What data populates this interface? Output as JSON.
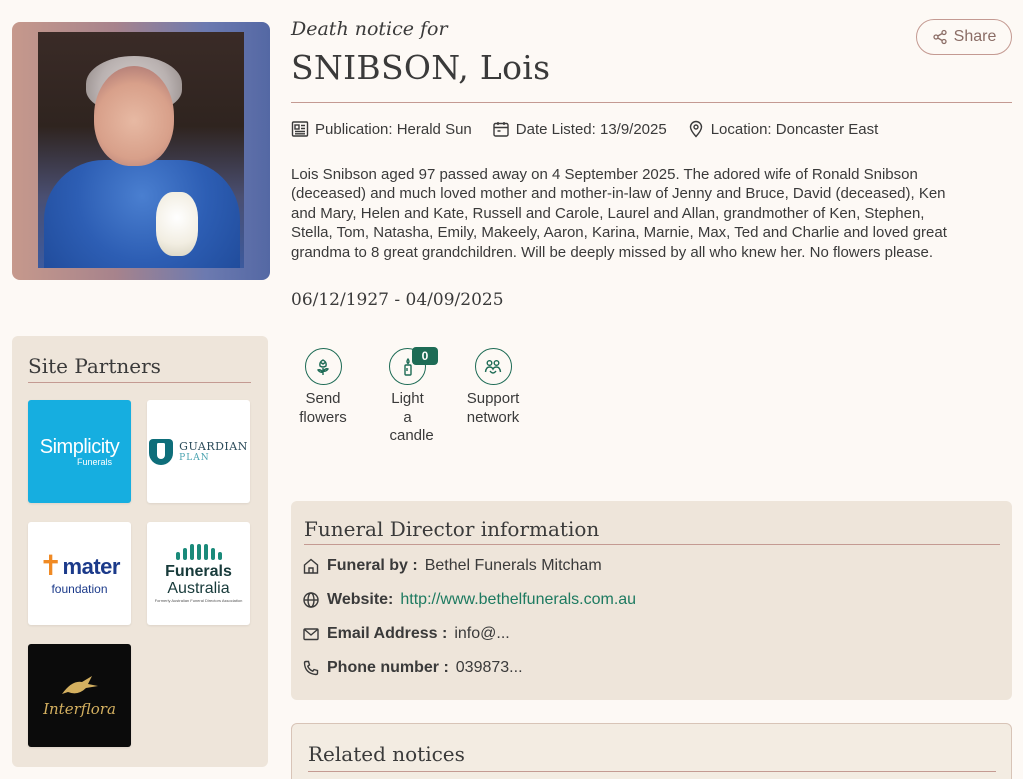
{
  "notice": {
    "heading": "Death notice for",
    "name": "SNIBSON, Lois",
    "share_label": "Share",
    "publication_label": "Publication: Herald Sun",
    "date_listed_label": "Date Listed: 13/9/2025",
    "location_label": "Location: Doncaster East",
    "body": "Lois Snibson aged 97 passed away on 4 September 2025. The adored wife of Ronald Snibson (deceased) and much loved mother and mother-in-law of Jenny and Bruce, David (deceased), Ken and Mary, Helen and Kate, Russell and Carole, Laurel and Allan, grandmother of Ken, Stephen, Stella, Tom, Natasha, Emily, Makeely, Aaron, Karina, Marnie, Max, Ted and Charlie and loved great grandma to 8 great grandchildren. Will be deeply missed by all who knew her. No flowers please.",
    "dates": "06/12/1927 - 04/09/2025"
  },
  "actions": {
    "send_flowers": "Send flowers",
    "light_candle": "Light a candle",
    "candle_count": "0",
    "support_network": "Support network"
  },
  "partners": {
    "title": "Site Partners",
    "simplicity_main": "Simplicity",
    "simplicity_sub": "Funerals",
    "guardian_t1": "GUARDIAN",
    "guardian_t2": "PLAN",
    "mater_word": "mater",
    "mater_sub": "foundation",
    "funerals_t1": "Funerals",
    "funerals_t2": "Australia",
    "funerals_t3": "Formerly Australian Funeral Directors Association",
    "interflora": "Interflora"
  },
  "director": {
    "title": "Funeral Director information",
    "funeral_by_key": "Funeral by :",
    "funeral_by_value": "Bethel Funerals Mitcham",
    "website_key": "Website:",
    "website_value": "http://www.bethelfunerals.com.au",
    "email_key": "Email Address :",
    "email_value": "info@...",
    "phone_key": "Phone number :",
    "phone_value": "039873..."
  },
  "related": {
    "title": "Related notices"
  },
  "colors": {
    "accent_green": "#1d6b55",
    "rule_rose": "#c49a92",
    "panel_beige": "#eee5da",
    "page_bg": "#fdf9f5"
  },
  "icons": {
    "share": "share-icon",
    "publication": "newspaper-icon",
    "date": "calendar-icon",
    "location": "map-pin-icon",
    "flowers": "flower-icon",
    "candle": "candle-icon",
    "support": "support-network-icon",
    "funeral_by": "home-icon",
    "website": "globe-icon",
    "email": "mail-icon",
    "phone": "phone-icon"
  }
}
